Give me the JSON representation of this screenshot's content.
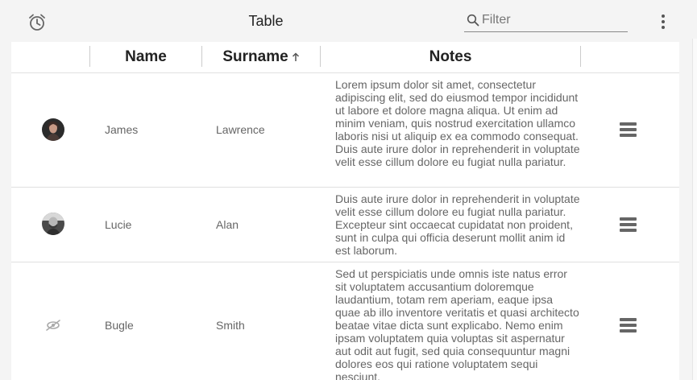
{
  "toolbar": {
    "alarm_icon": "alarm-clock-icon",
    "title": "Table",
    "filter_placeholder": "Filter",
    "search_icon": "search-icon",
    "more_icon": "more-vertical-icon"
  },
  "table": {
    "columns": [
      {
        "label": ""
      },
      {
        "label": "Name"
      },
      {
        "label": "Surname",
        "sorted": "ascending"
      },
      {
        "label": "Notes"
      }
    ],
    "rows": [
      {
        "avatar": "photo-avatar",
        "name": "James",
        "surname": "Lawrence",
        "notes": "Lorem ipsum dolor sit amet, consectetur adipiscing elit, sed do eiusmod tempor incididunt ut labore et dolore magna aliqua. Ut enim ad minim veniam, quis nostrud exercitation ullamco laboris nisi ut aliquip ex ea commodo consequat. Duis aute irure dolor in reprehenderit in voluptate velit esse cillum dolore eu fugiat nulla pariatur.",
        "action_icon": "list-icon"
      },
      {
        "avatar": "photo-avatar",
        "name": "Lucie",
        "surname": "Alan",
        "notes": "Duis aute irure dolor in reprehenderit in voluptate velit esse cillum dolore eu fugiat nulla pariatur. Excepteur sint occaecat cupidatat non proident, sunt in culpa qui officia deserunt mollit anim id est laborum.",
        "action_icon": "list-icon"
      },
      {
        "avatar": "no-image-icon",
        "name": "Bugle",
        "surname": "Smith",
        "notes": "Sed ut perspiciatis unde omnis iste natus error sit voluptatem accusantium doloremque laudantium, totam rem aperiam, eaque ipsa quae ab illo inventore veritatis et quasi architecto beatae vitae dicta sunt explicabo. Nemo enim ipsam voluptatem quia voluptas sit aspernatur aut odit aut fugit, sed quia consequuntur magni dolores eos qui ratione voluptatem sequi nesciunt.",
        "action_icon": "list-icon"
      }
    ]
  }
}
